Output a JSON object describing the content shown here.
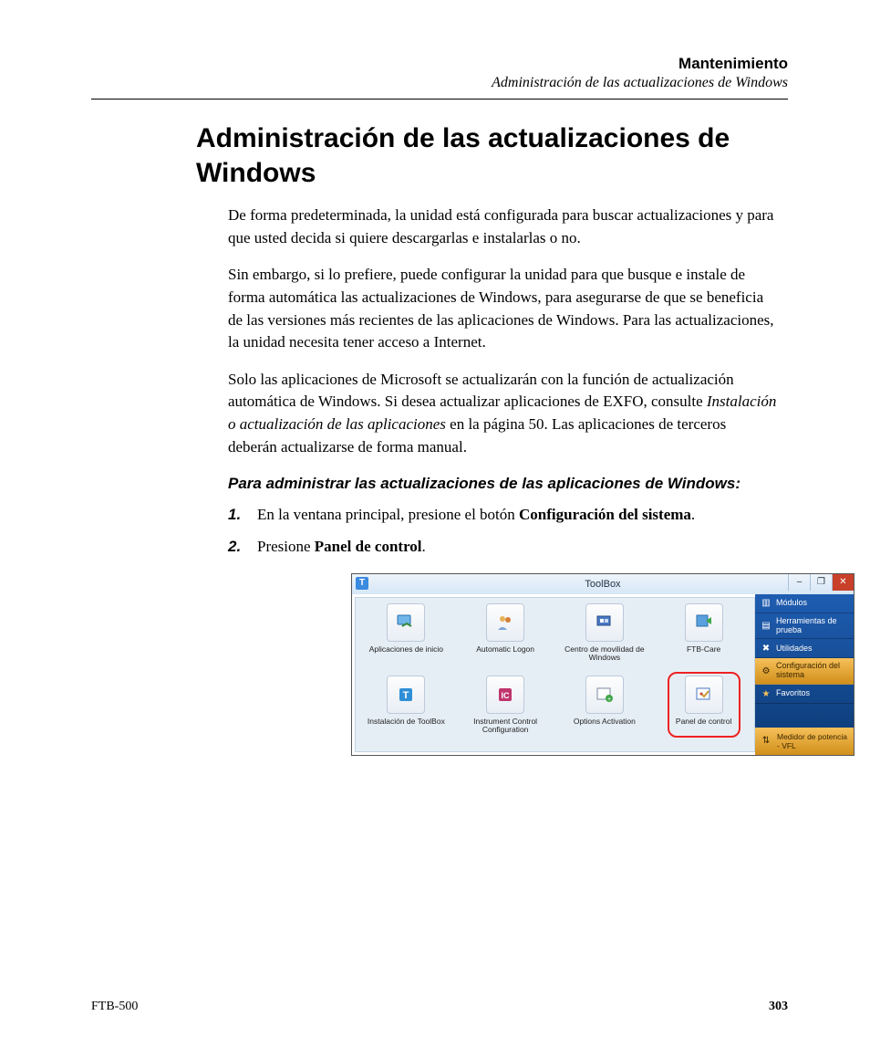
{
  "header": {
    "title": "Mantenimiento",
    "subtitle": "Administración de las actualizaciones de Windows"
  },
  "h1": "Administración de las actualizaciones de Windows",
  "para1": "De forma predeterminada, la unidad está configurada para buscar actualizaciones y para que usted decida si quiere descargarlas e instalarlas o no.",
  "para2": "Sin embargo, si lo prefiere, puede configurar la unidad para que busque e instale de forma automática las actualizaciones de Windows, para asegurarse de que se beneficia de las versiones más recientes de las aplicaciones de Windows. Para las actualizaciones, la unidad necesita tener acceso a Internet.",
  "para3_a": "Solo las aplicaciones de Microsoft se actualizarán con la función de actualización automática de Windows. Si desea actualizar aplicaciones de EXFO, consulte ",
  "para3_i": "Instalación o actualización de las aplicaciones",
  "para3_b": " en la página 50. Las aplicaciones de terceros deberán actualizarse de forma manual.",
  "subhead": "Para administrar las actualizaciones de las aplicaciones de Windows:",
  "steps": {
    "n1": "1.",
    "s1a": "En la ventana principal, presione el botón ",
    "s1b": "Configuración del sistema",
    "s1c": ".",
    "n2": "2.",
    "s2a": "Presione ",
    "s2b": "Panel de control",
    "s2c": "."
  },
  "toolbox": {
    "title": "ToolBox",
    "t_letter": "T",
    "win_min": "–",
    "win_max": "❐",
    "win_close": "✕",
    "tiles": [
      {
        "label": "Aplicaciones de inicio"
      },
      {
        "label": "Automatic Logon"
      },
      {
        "label": "Centro de movilidad de Windows"
      },
      {
        "label": "FTB-Care"
      },
      {
        "label": "Instalación de ToolBox"
      },
      {
        "label": "Instrument Control Configuration"
      },
      {
        "label": "Options Activation"
      },
      {
        "label": "Panel de control"
      }
    ],
    "sidebar": [
      {
        "label": "Módulos",
        "active": false,
        "icon": "▥"
      },
      {
        "label": "Herramientas de prueba",
        "active": false,
        "icon": "▤"
      },
      {
        "label": "Utilidades",
        "active": false,
        "icon": "✖"
      },
      {
        "label": "Configuración del sistema",
        "active": true,
        "icon": "⚙"
      },
      {
        "label": "Favoritos",
        "active": false,
        "icon": "★"
      }
    ],
    "bottom": {
      "label": "Medidor de potencia - VFL",
      "icon": "⇅"
    }
  },
  "footer": {
    "left": "FTB-500",
    "right": "303"
  }
}
